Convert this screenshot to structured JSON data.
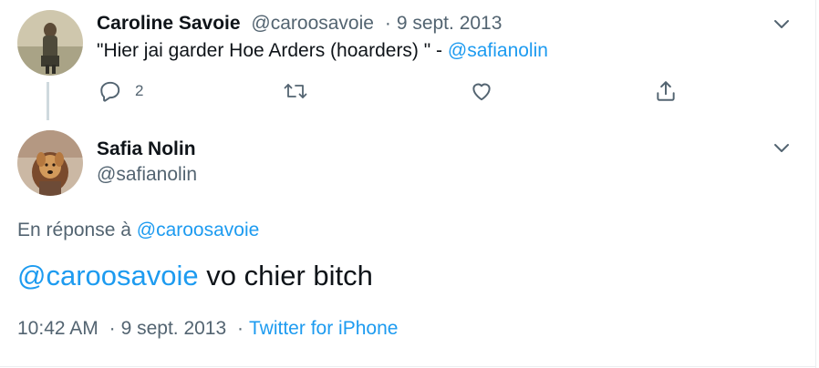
{
  "parent_tweet": {
    "author_name": "Caroline Savoie",
    "author_handle": "@caroosavoie",
    "separator": "·",
    "date": "9 sept. 2013",
    "text_main": "\"Hier jai garder Hoe Arders (hoarders) \" - ",
    "text_mention": "@safianolin",
    "reply_count": "2",
    "avatar_icon": "person-standing-avatar"
  },
  "main_tweet": {
    "author_name": "Safia Nolin",
    "author_handle": "@safianolin",
    "avatar_icon": "person-with-dog-avatar",
    "reply_prefix": "En réponse à ",
    "reply_to": "@caroosavoie",
    "body_mention": "@caroosavoie",
    "body_text": " vo chier bitch",
    "time": "10:42 AM",
    "separator": "·",
    "date": "9 sept. 2013",
    "source": "Twitter for iPhone"
  },
  "icons": {
    "caret": "chevron-down-icon",
    "reply": "reply-icon",
    "retweet": "retweet-icon",
    "like": "heart-icon",
    "share": "share-icon"
  },
  "colors": {
    "accent": "#1d9bf0",
    "muted": "#536471",
    "text": "#0f1419",
    "divider": "#ebeef0",
    "thread_line": "#cfd9de"
  }
}
